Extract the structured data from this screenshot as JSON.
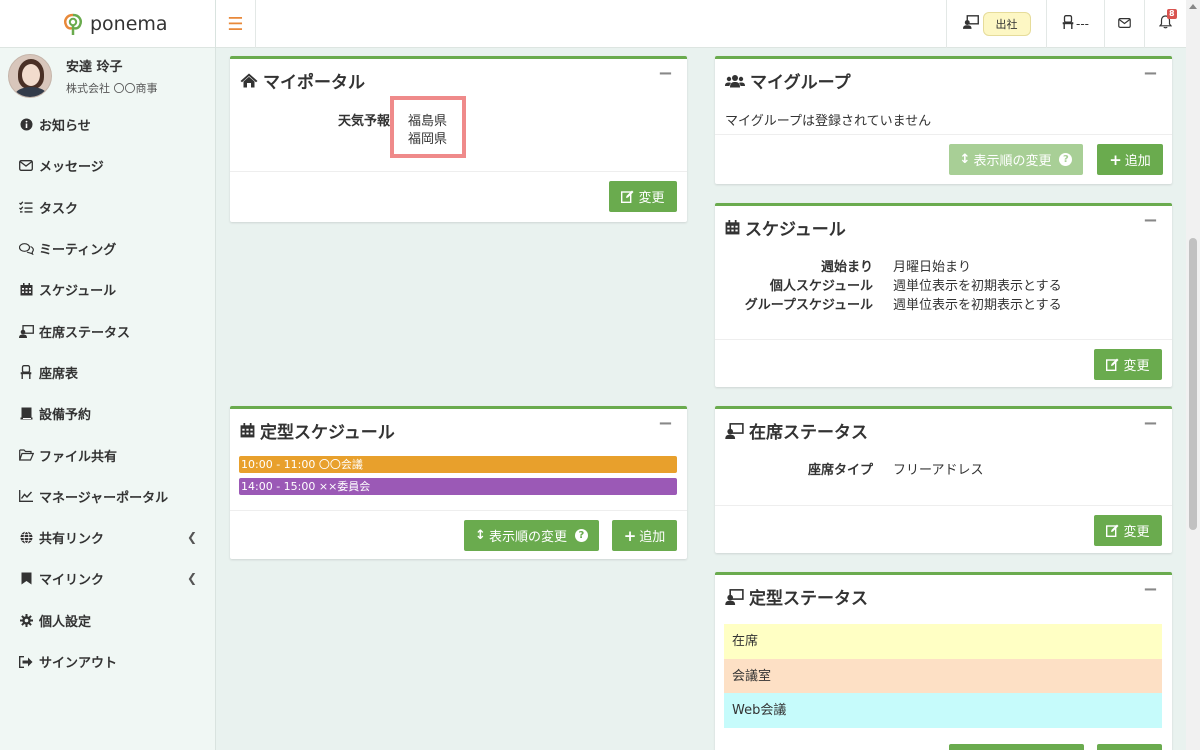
{
  "brand": {
    "name": "ponema"
  },
  "user": {
    "name": "安達 玲子",
    "company": "株式会社 〇〇商事"
  },
  "nav": [
    {
      "label": "お知らせ",
      "icon": "info-circle-icon"
    },
    {
      "label": "メッセージ",
      "icon": "envelope-icon"
    },
    {
      "label": "タスク",
      "icon": "task-list-icon"
    },
    {
      "label": "ミーティング",
      "icon": "chat-bubbles-icon"
    },
    {
      "label": "スケジュール",
      "icon": "calendar-icon"
    },
    {
      "label": "在席ステータス",
      "icon": "presence-icon"
    },
    {
      "label": "座席表",
      "icon": "seat-icon"
    },
    {
      "label": "設備予約",
      "icon": "book-icon"
    },
    {
      "label": "ファイル共有",
      "icon": "folder-icon"
    },
    {
      "label": "マネージャーポータル",
      "icon": "chart-icon"
    },
    {
      "label": "共有リンク",
      "icon": "globe-icon"
    },
    {
      "label": "マイリンク",
      "icon": "bookmark-icon"
    },
    {
      "label": "個人設定",
      "icon": "gear-icon"
    },
    {
      "label": "サインアウト",
      "icon": "sign-out-icon"
    }
  ],
  "header": {
    "status_label": "出社",
    "seat_label": "---",
    "notification_count": "8"
  },
  "my_portal": {
    "title": "マイポータル",
    "weather_label": "天気予報",
    "weather_values": [
      "福島県",
      "福岡県"
    ],
    "edit_label": "変更"
  },
  "my_group": {
    "title": "マイグループ",
    "empty_text": "マイグループは登録されていません",
    "reorder_label": "表示順の変更",
    "add_label": "追加"
  },
  "schedule": {
    "title": "スケジュール",
    "rows": [
      {
        "label": "週始まり",
        "value": "月曜日始まり"
      },
      {
        "label": "個人スケジュール",
        "value": "週単位表示を初期表示とする"
      },
      {
        "label": "グループスケジュール",
        "value": "週単位表示を初期表示とする"
      }
    ],
    "edit_label": "変更"
  },
  "fixed_schedule": {
    "title": "定型スケジュール",
    "items": [
      {
        "text": "10:00 - 11:00 〇〇会議",
        "color": "#e8a02c"
      },
      {
        "text": "14:00 - 15:00 ××委員会",
        "color": "#9b59b6"
      }
    ],
    "reorder_label": "表示順の変更",
    "add_label": "追加"
  },
  "presence_status": {
    "title": "在席ステータス",
    "seat_type_label": "座席タイプ",
    "seat_type_value": "フリーアドレス",
    "edit_label": "変更"
  },
  "fixed_status": {
    "title": "定型ステータス",
    "items": [
      {
        "label": "在席",
        "color": "#ffffc4"
      },
      {
        "label": "会議室",
        "color": "#fde0c5"
      },
      {
        "label": "Web会議",
        "color": "#c6fbfb"
      }
    ]
  },
  "colors": {
    "accent": "#6aab4e",
    "highlight_box": "#ef8a8a",
    "hamburger": "#e8893a"
  }
}
